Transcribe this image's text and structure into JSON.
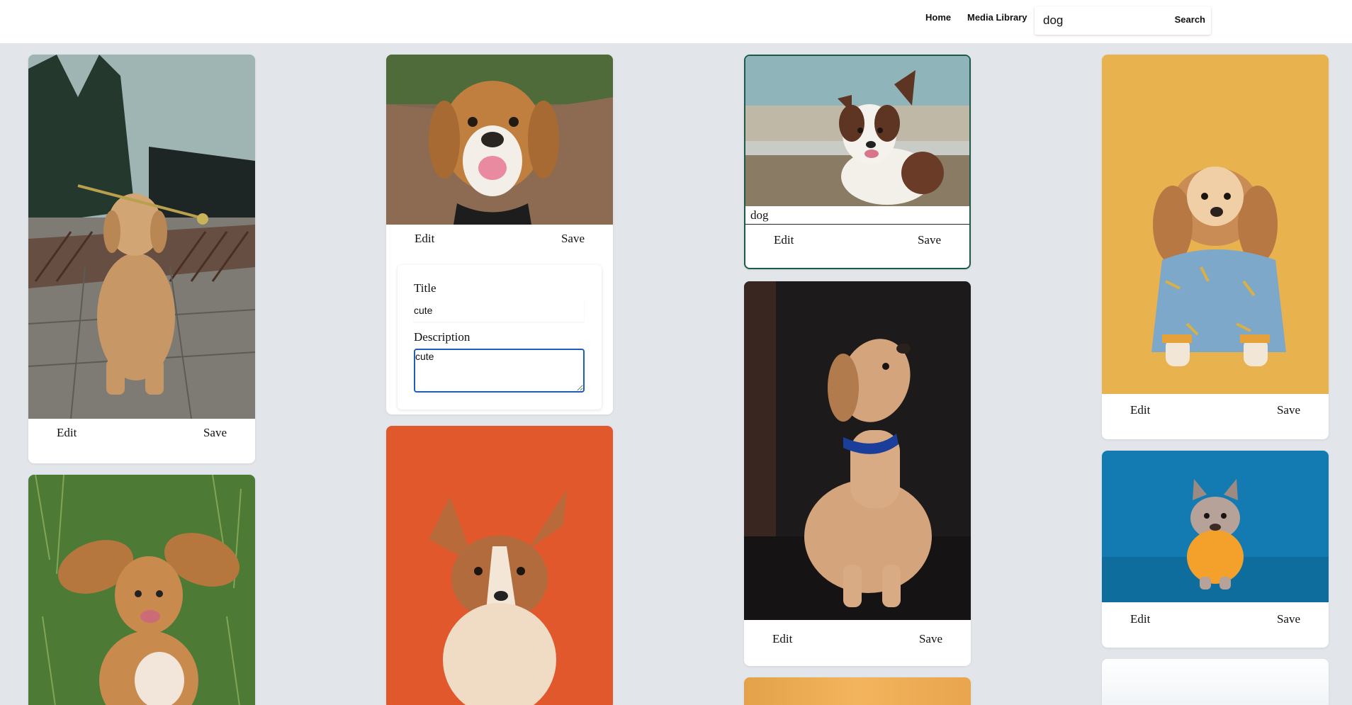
{
  "nav": {
    "home_label": "Home",
    "media_library_label": "Media Library"
  },
  "search": {
    "value": "dog",
    "button_label": "Search"
  },
  "cards": [
    {
      "id": "golden-rose",
      "edit_label": "Edit",
      "save_label": "Save"
    },
    {
      "id": "spaniel-grass"
    },
    {
      "id": "beagle",
      "edit_label": "Edit",
      "save_label": "Save",
      "form": {
        "title_label": "Title",
        "title_value": "cute",
        "description_label": "Description",
        "description_value": "cute"
      }
    },
    {
      "id": "corgi-orange"
    },
    {
      "id": "aussie-beach",
      "caption_value": "dog",
      "edit_label": "Edit",
      "save_label": "Save"
    },
    {
      "id": "lab-dark",
      "edit_label": "Edit",
      "save_label": "Save"
    },
    {
      "id": "yellow-partial"
    },
    {
      "id": "poodle-yellow",
      "edit_label": "Edit",
      "save_label": "Save"
    },
    {
      "id": "frenchie-blue",
      "edit_label": "Edit",
      "save_label": "Save"
    },
    {
      "id": "white-partial"
    }
  ],
  "colors": {
    "background": "#e2e5ea",
    "selected_border": "#1f5a48",
    "focus_border": "#1d5fb3"
  }
}
